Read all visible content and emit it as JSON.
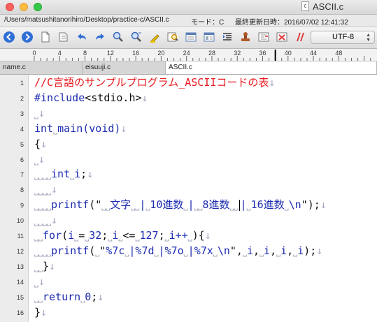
{
  "window": {
    "title": "ASCII.c",
    "doc_icon_letter": "C",
    "path": "/Users/matsushitanorihiro/Desktop/practice-c/ASCII.c",
    "mode": "モード：C",
    "last_modified": "最終更新日時：2016/07/02 12:41:32"
  },
  "toolbar": {
    "encoding": "UTF-8",
    "buttons": [
      {
        "icon": "back-arrow-icon"
      },
      {
        "icon": "forward-arrow-icon"
      },
      {
        "icon": "new-document-icon"
      },
      {
        "icon": "open-folder-icon"
      },
      {
        "icon": "undo-icon"
      },
      {
        "icon": "redo-icon"
      },
      {
        "icon": "find-icon"
      },
      {
        "icon": "find-next-icon"
      },
      {
        "icon": "highlight-icon"
      },
      {
        "icon": "find-in-files-icon"
      },
      {
        "icon": "window-split-icon"
      },
      {
        "icon": "window-list-icon"
      },
      {
        "icon": "indent-icon"
      },
      {
        "icon": "stamp-icon"
      },
      {
        "icon": "compare-icon"
      },
      {
        "icon": "no-entry-icon"
      },
      {
        "icon": "double-slash-icon"
      }
    ]
  },
  "ruler": {
    "labels": [
      "0",
      "4",
      "8",
      "12",
      "16",
      "20",
      "24",
      "28",
      "32",
      "36",
      "40",
      "44",
      "48"
    ]
  },
  "tabs": [
    {
      "label": "name.c",
      "active": false
    },
    {
      "label": "eisuuji.c",
      "active": false
    },
    {
      "label": "ASCII.c",
      "active": true
    }
  ],
  "colors": {
    "keyword": "#1c2bb0",
    "comment": "#e8191e",
    "whitespace_marker": "#a8a8c0"
  },
  "code": {
    "line_numbers": [
      "1",
      "2",
      "3",
      "4",
      "5",
      "6",
      "7",
      "8",
      "9",
      "10",
      "11",
      "12",
      "13",
      "14",
      "15",
      "16"
    ],
    "lines": [
      {
        "segments": [
          {
            "t": "//C言語のサンプルプログラム_ASCIIコードの表",
            "c": "red"
          },
          {
            "t": "↓",
            "c": "mk"
          }
        ]
      },
      {
        "segments": [
          {
            "t": "#include",
            "c": "kw"
          },
          {
            "t": "<stdio.h>",
            "c": "txt"
          },
          {
            "t": "↓",
            "c": "mk"
          }
        ]
      },
      {
        "segments": [
          {
            "t": "⎵",
            "c": "mk"
          },
          {
            "t": "↓",
            "c": "mk"
          }
        ]
      },
      {
        "segments": [
          {
            "t": "int",
            "c": "kw"
          },
          {
            "t": "⎵",
            "c": "mk"
          },
          {
            "t": "main",
            "c": "kw"
          },
          {
            "t": "(void)",
            "c": "kw"
          },
          {
            "t": "↓",
            "c": "mk"
          }
        ]
      },
      {
        "segments": [
          {
            "t": "{",
            "c": "txt"
          },
          {
            "t": "↓",
            "c": "mk"
          }
        ]
      },
      {
        "segments": [
          {
            "t": "⎵",
            "c": "mk"
          },
          {
            "t": "↓",
            "c": "mk"
          }
        ]
      },
      {
        "segments": [
          {
            "t": "⎵⎵⎵⎵",
            "c": "mk"
          },
          {
            "t": "int",
            "c": "kw"
          },
          {
            "t": "⎵",
            "c": "mk"
          },
          {
            "t": "i",
            "c": "kw"
          },
          {
            "t": ";",
            "c": "txt"
          },
          {
            "t": "↓",
            "c": "mk"
          }
        ]
      },
      {
        "segments": [
          {
            "t": "⎵⎵⎵⎵",
            "c": "mk"
          },
          {
            "t": "↓",
            "c": "mk"
          }
        ]
      },
      {
        "segments": [
          {
            "t": "⎵⎵⎵⎵",
            "c": "mk"
          },
          {
            "t": "printf",
            "c": "kw"
          },
          {
            "t": "(\"",
            "c": "txt"
          },
          {
            "t": "⎵⎵",
            "c": "mk"
          },
          {
            "t": "文字",
            "c": "kw"
          },
          {
            "t": "⎵⎵",
            "c": "mk"
          },
          {
            "t": "|",
            "c": "kw"
          },
          {
            "t": "⎵",
            "c": "mk"
          },
          {
            "t": "10進数",
            "c": "kw"
          },
          {
            "t": "⎵",
            "c": "mk"
          },
          {
            "t": "|",
            "c": "kw"
          },
          {
            "t": "⎵⎵",
            "c": "mk"
          },
          {
            "t": "8進数",
            "c": "kw"
          },
          {
            "t": "⎵⎵",
            "c": "mk"
          },
          {
            "t": "CARET",
            "c": "caret"
          },
          {
            "t": "|",
            "c": "kw"
          },
          {
            "t": "⎵",
            "c": "mk"
          },
          {
            "t": "16進数",
            "c": "kw"
          },
          {
            "t": "⎵",
            "c": "mk"
          },
          {
            "t": "\\n",
            "c": "kw"
          },
          {
            "t": "\");",
            "c": "txt"
          },
          {
            "t": "↓",
            "c": "mk"
          }
        ]
      },
      {
        "segments": [
          {
            "t": "⎵⎵⎵⎵",
            "c": "mk"
          },
          {
            "t": "↓",
            "c": "mk"
          }
        ]
      },
      {
        "segments": [
          {
            "t": "⎵⎵",
            "c": "mk"
          },
          {
            "t": "for",
            "c": "kw"
          },
          {
            "t": "(",
            "c": "txt"
          },
          {
            "t": "i",
            "c": "kw"
          },
          {
            "t": "⎵",
            "c": "mk"
          },
          {
            "t": "=",
            "c": "txt"
          },
          {
            "t": "⎵",
            "c": "mk"
          },
          {
            "t": "32",
            "c": "kw"
          },
          {
            "t": ";",
            "c": "txt"
          },
          {
            "t": "⎵",
            "c": "mk"
          },
          {
            "t": "i",
            "c": "kw"
          },
          {
            "t": "⎵",
            "c": "mk"
          },
          {
            "t": "<=",
            "c": "txt"
          },
          {
            "t": "⎵",
            "c": "mk"
          },
          {
            "t": "127",
            "c": "kw"
          },
          {
            "t": ";",
            "c": "txt"
          },
          {
            "t": "⎵",
            "c": "mk"
          },
          {
            "t": "i++",
            "c": "kw"
          },
          {
            "t": "⎵",
            "c": "mk"
          },
          {
            "t": "){",
            "c": "txt"
          },
          {
            "t": "↓",
            "c": "mk"
          }
        ]
      },
      {
        "segments": [
          {
            "t": "⎵⎵⎵⎵",
            "c": "mk"
          },
          {
            "t": "printf",
            "c": "kw"
          },
          {
            "t": "(",
            "c": "txt"
          },
          {
            "t": "⎵",
            "c": "mk"
          },
          {
            "t": "\"",
            "c": "txt"
          },
          {
            "t": "%7c",
            "c": "kw"
          },
          {
            "t": "⎵",
            "c": "mk"
          },
          {
            "t": "|%7d",
            "c": "kw"
          },
          {
            "t": "⎵",
            "c": "mk"
          },
          {
            "t": "|%7o",
            "c": "kw"
          },
          {
            "t": "⎵",
            "c": "mk"
          },
          {
            "t": "|%7x",
            "c": "kw"
          },
          {
            "t": "⎵",
            "c": "mk"
          },
          {
            "t": "\\n",
            "c": "kw"
          },
          {
            "t": "\",",
            "c": "txt"
          },
          {
            "t": "⎵",
            "c": "mk"
          },
          {
            "t": "i",
            "c": "kw"
          },
          {
            "t": ",",
            "c": "txt"
          },
          {
            "t": "⎵",
            "c": "mk"
          },
          {
            "t": "i",
            "c": "kw"
          },
          {
            "t": ",",
            "c": "txt"
          },
          {
            "t": "⎵",
            "c": "mk"
          },
          {
            "t": "i",
            "c": "kw"
          },
          {
            "t": ",",
            "c": "txt"
          },
          {
            "t": "⎵",
            "c": "mk"
          },
          {
            "t": "i",
            "c": "kw"
          },
          {
            "t": ");",
            "c": "txt"
          },
          {
            "t": "↓",
            "c": "mk"
          }
        ]
      },
      {
        "segments": [
          {
            "t": "⎵⎵",
            "c": "mk"
          },
          {
            "t": "}",
            "c": "txt"
          },
          {
            "t": "↓",
            "c": "mk"
          }
        ]
      },
      {
        "segments": [
          {
            "t": "⎵",
            "c": "mk"
          },
          {
            "t": "↓",
            "c": "mk"
          }
        ]
      },
      {
        "segments": [
          {
            "t": "⎵⎵",
            "c": "mk"
          },
          {
            "t": "return",
            "c": "kw"
          },
          {
            "t": "⎵",
            "c": "mk"
          },
          {
            "t": "0",
            "c": "kw"
          },
          {
            "t": ";",
            "c": "txt"
          },
          {
            "t": "↓",
            "c": "mk"
          }
        ]
      },
      {
        "segments": [
          {
            "t": "}",
            "c": "txt"
          },
          {
            "t": "↓",
            "c": "mk"
          }
        ]
      }
    ]
  }
}
